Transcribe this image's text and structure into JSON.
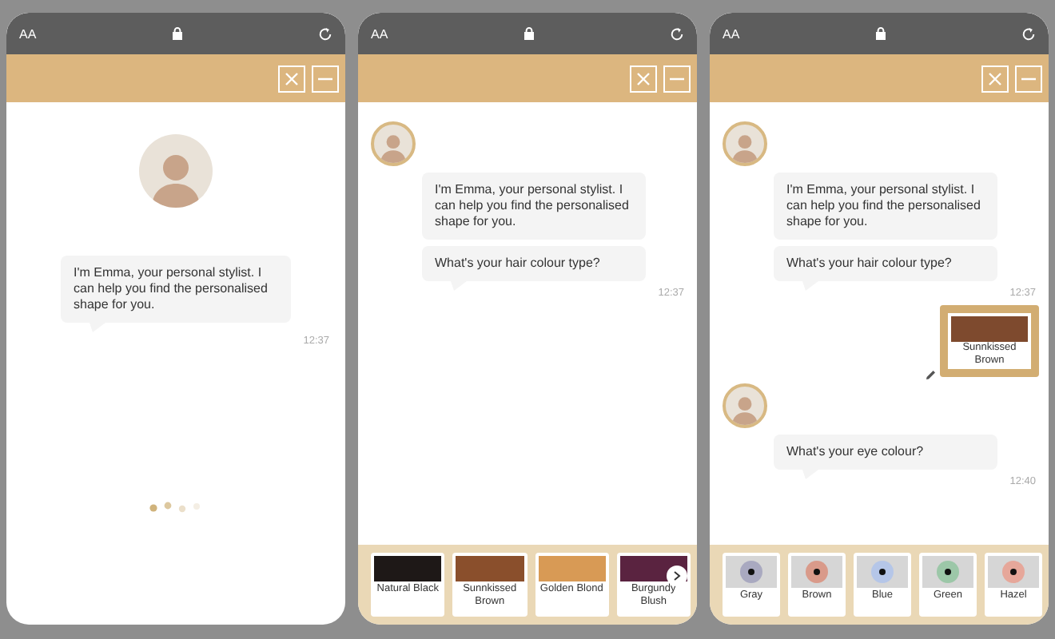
{
  "screens": [
    {
      "kind": "intro",
      "browser": {
        "text_size": "AA"
      },
      "message": "I'm Emma, your personal stylist. I can help you find the personalised shape for you.",
      "time": "12:37"
    },
    {
      "kind": "chat",
      "browser": {
        "text_size": "AA"
      },
      "chat": [
        {
          "kind": "bot",
          "bubbles": [
            "I'm Emma, your personal stylist. I can help you find the personalised shape for you.",
            "What's your hair colour type?"
          ],
          "time": "12:37"
        }
      ],
      "footer": {
        "kind": "hair",
        "has_next": true,
        "options": [
          {
            "label": "Natural Black",
            "color": "#1e1817"
          },
          {
            "label": "Sunnkissed Brown",
            "color": "#8a4f2c"
          },
          {
            "label": "Golden Blond",
            "color": "#d89a55"
          },
          {
            "label": "Burgundy Blush",
            "color": "#5a2340"
          }
        ]
      }
    },
    {
      "kind": "chat",
      "browser": {
        "text_size": "AA"
      },
      "chat": [
        {
          "kind": "bot",
          "bubbles": [
            "I'm Emma, your personal stylist. I can help you find the personalised shape for you.",
            "What's your hair colour type?"
          ],
          "time": "12:37"
        },
        {
          "kind": "user",
          "label": "Sunnkissed Brown",
          "color": "#7e4a2e"
        },
        {
          "kind": "bot",
          "bubbles": [
            "What's your eye colour?"
          ],
          "time": "12:40"
        }
      ],
      "footer": {
        "kind": "eye",
        "has_next": false,
        "options": [
          {
            "label": "Gray",
            "color": "#a9a9c0"
          },
          {
            "label": "Brown",
            "color": "#d99a8a"
          },
          {
            "label": "Blue",
            "color": "#b5c6e8"
          },
          {
            "label": "Green",
            "color": "#9cc7a8"
          },
          {
            "label": "Hazel",
            "color": "#e6a79a"
          }
        ]
      }
    }
  ]
}
